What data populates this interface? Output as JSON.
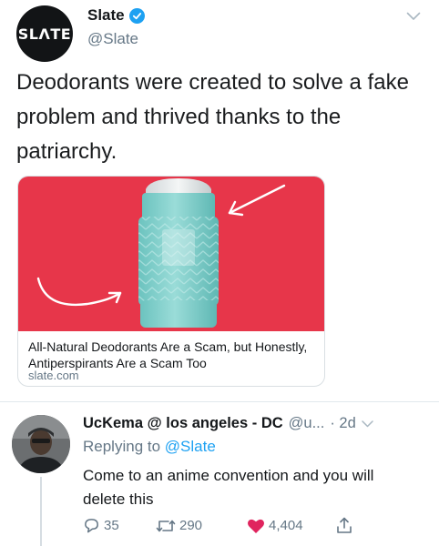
{
  "tweet": {
    "avatar_text": "SLΛTE",
    "author_name": "Slate",
    "author_handle": "@Slate",
    "text": "Deodorants were created to solve a fake problem and thrived thanks to the patriarchy.",
    "card": {
      "title": "All-Natural Deodorants Are a Scam, but Honestly, Antiperspirants Are a Scam Too",
      "domain": "slate.com"
    }
  },
  "reply": {
    "author_name": "UcKema @ los angeles - DC",
    "author_handle": "@u...",
    "time": "· 2d",
    "replying_prefix": "Replying to",
    "replying_to": "@Slate",
    "text": "Come to an anime convention and you will delete this",
    "reply_count": "35",
    "retweet_count": "290",
    "like_count": "4,404"
  },
  "icons": {
    "verified": "verified-badge-icon",
    "caret": "chevron-down-icon",
    "reply": "reply-bubble-icon",
    "retweet": "retweet-icon",
    "like": "heart-icon",
    "share": "share-icon"
  },
  "colors": {
    "card_background": "#e7364a",
    "stick_body": "#8fd6d3",
    "link_blue": "#1da1f2",
    "like_red": "#e0245e"
  }
}
